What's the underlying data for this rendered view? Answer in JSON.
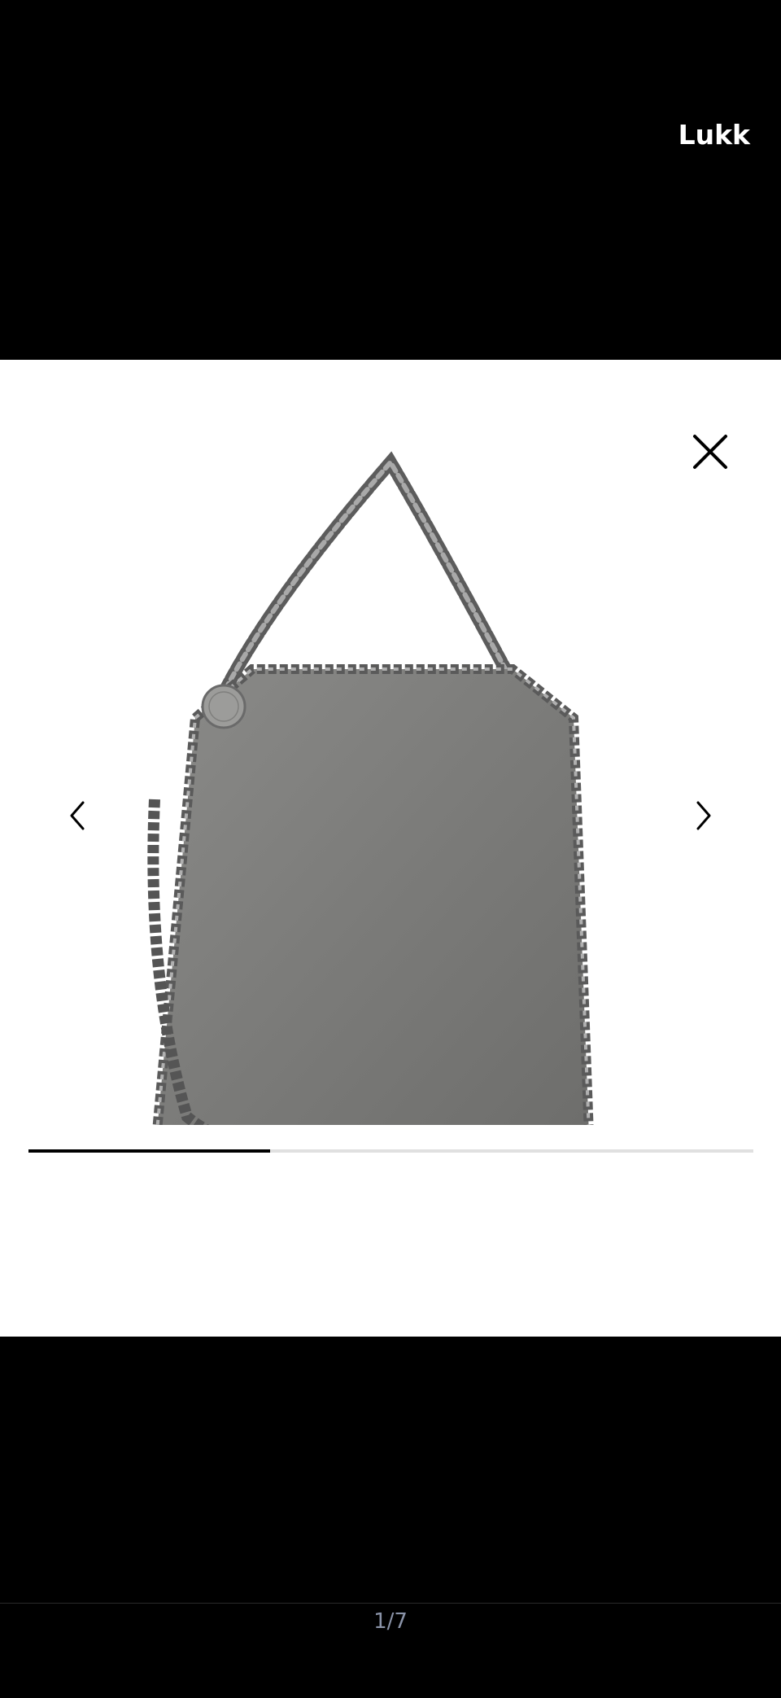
{
  "header": {
    "close_label": "Lukk"
  },
  "gallery": {
    "close_icon": "close-icon",
    "prev_icon": "chevron-left-icon",
    "next_icon": "chevron-right-icon",
    "current_index": 1,
    "total": 7,
    "progress_fraction": 0.333,
    "counter_text": "1/7"
  },
  "colors": {
    "background": "#000000",
    "viewer": "#ffffff",
    "counter": "#8a93a8",
    "progress_track": "#e0e0e0",
    "progress_fill": "#000000"
  }
}
